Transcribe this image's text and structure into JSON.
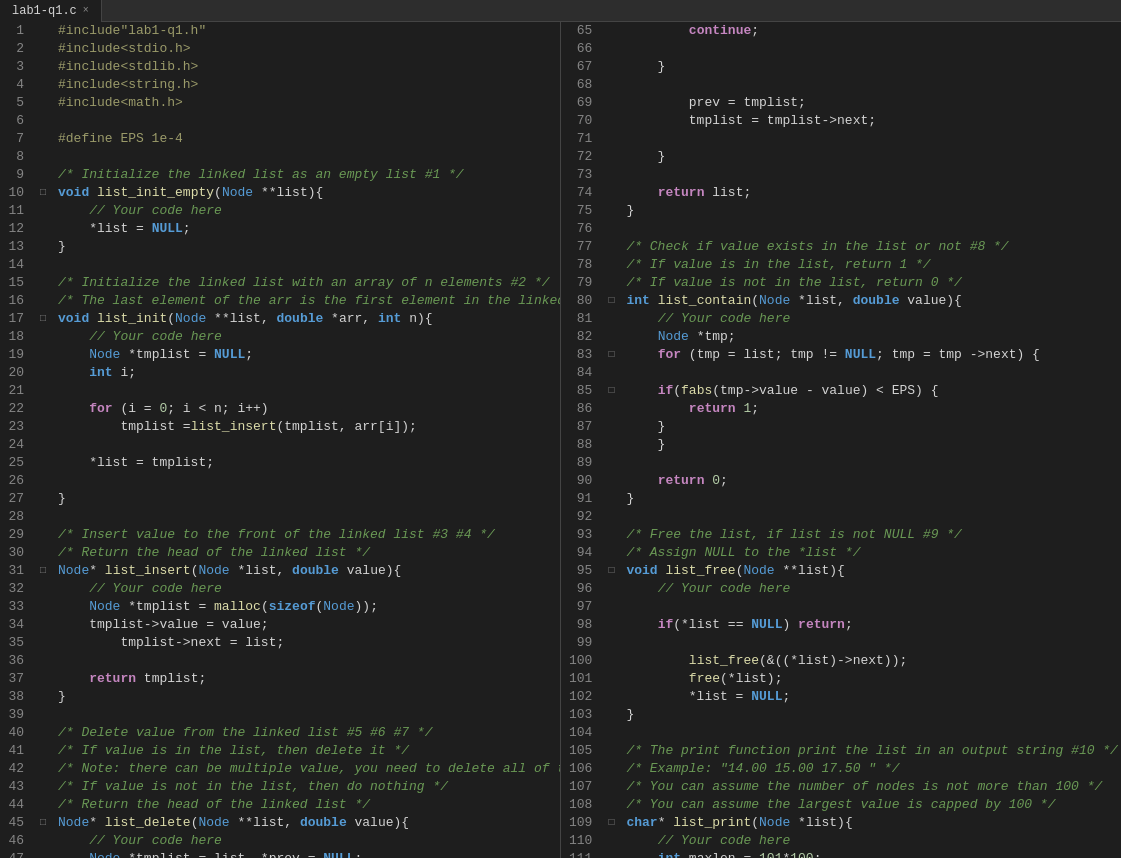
{
  "tab": {
    "label": "lab1-q1.c",
    "close": "×"
  },
  "colors": {
    "bg": "#1e1e1e",
    "tabBg": "#2d2d2d",
    "lineNum": "#858585",
    "keyword": "#569cd6",
    "keyword2": "#c586c0",
    "fn": "#dcdcaa",
    "string": "#ce9178",
    "number": "#b5cea8",
    "comment": "#6a9955",
    "preproc": "#9b9b6a",
    "text": "#d4d4d4",
    "varname": "#9cdcfe"
  }
}
